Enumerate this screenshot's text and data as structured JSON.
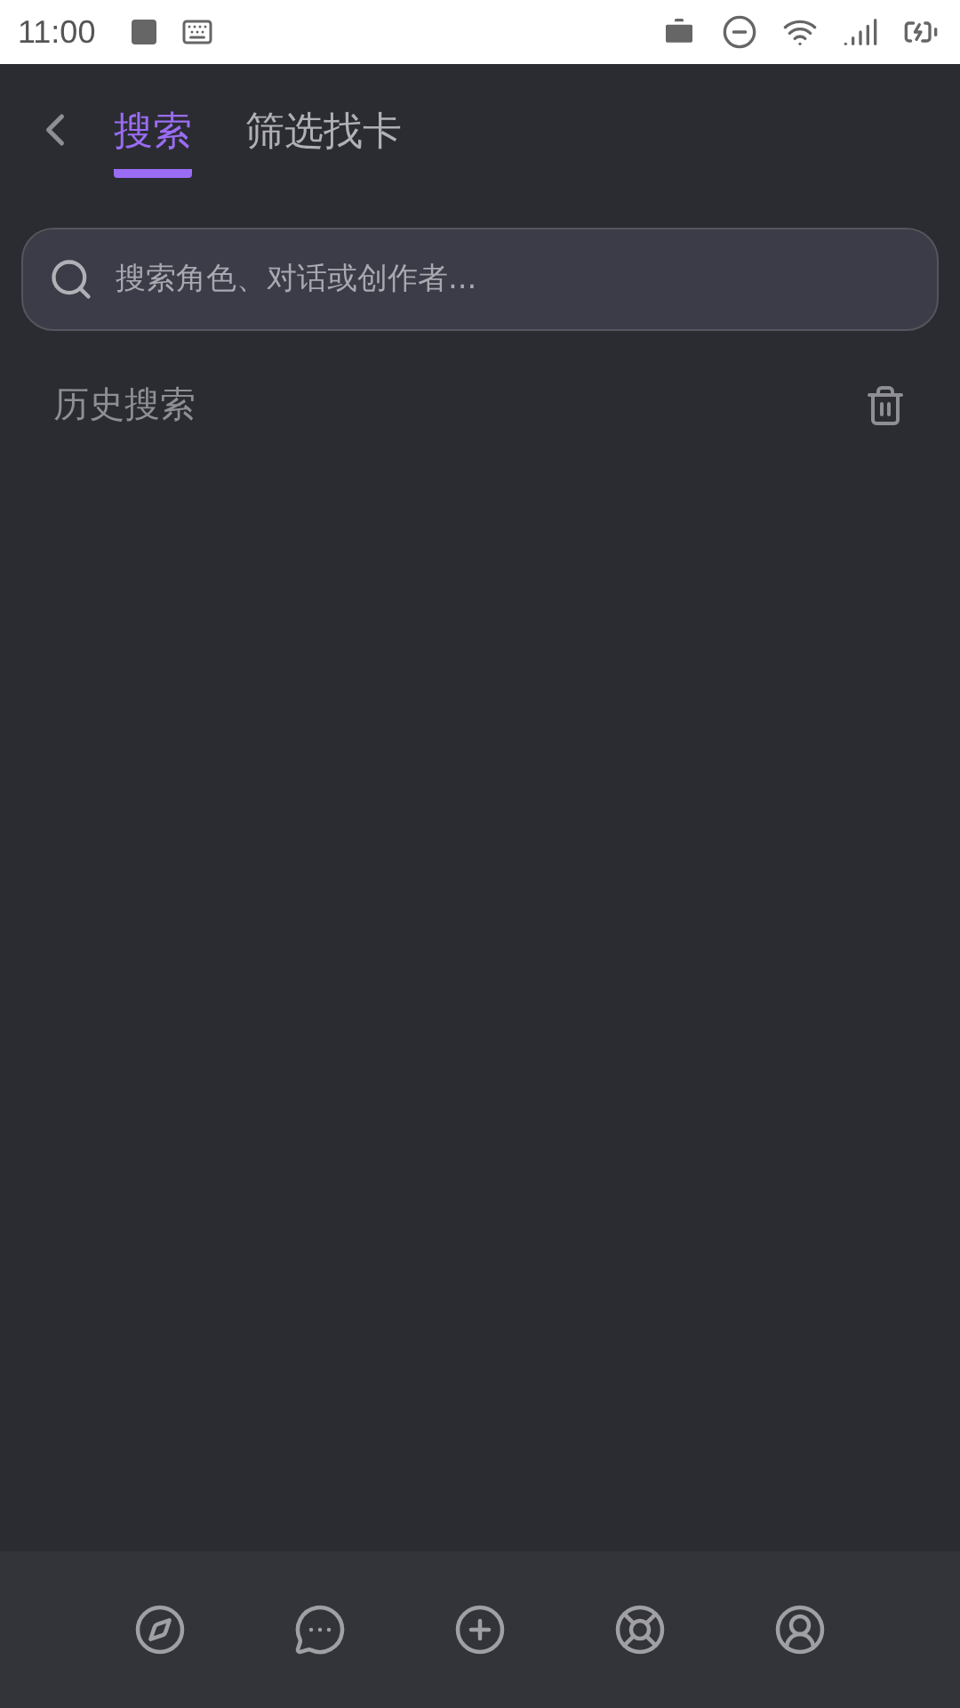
{
  "status_bar": {
    "time": "11:00"
  },
  "tabs": [
    {
      "label": "搜索",
      "selected": true
    },
    {
      "label": "筛选找卡",
      "selected": false
    }
  ],
  "search": {
    "placeholder": "搜索角色、对话或创作者..."
  },
  "history": {
    "title": "历史搜索"
  },
  "bottom_nav": [
    {
      "kind": "discover"
    },
    {
      "kind": "chat"
    },
    {
      "kind": "create"
    },
    {
      "kind": "help"
    },
    {
      "kind": "profile"
    }
  ]
}
